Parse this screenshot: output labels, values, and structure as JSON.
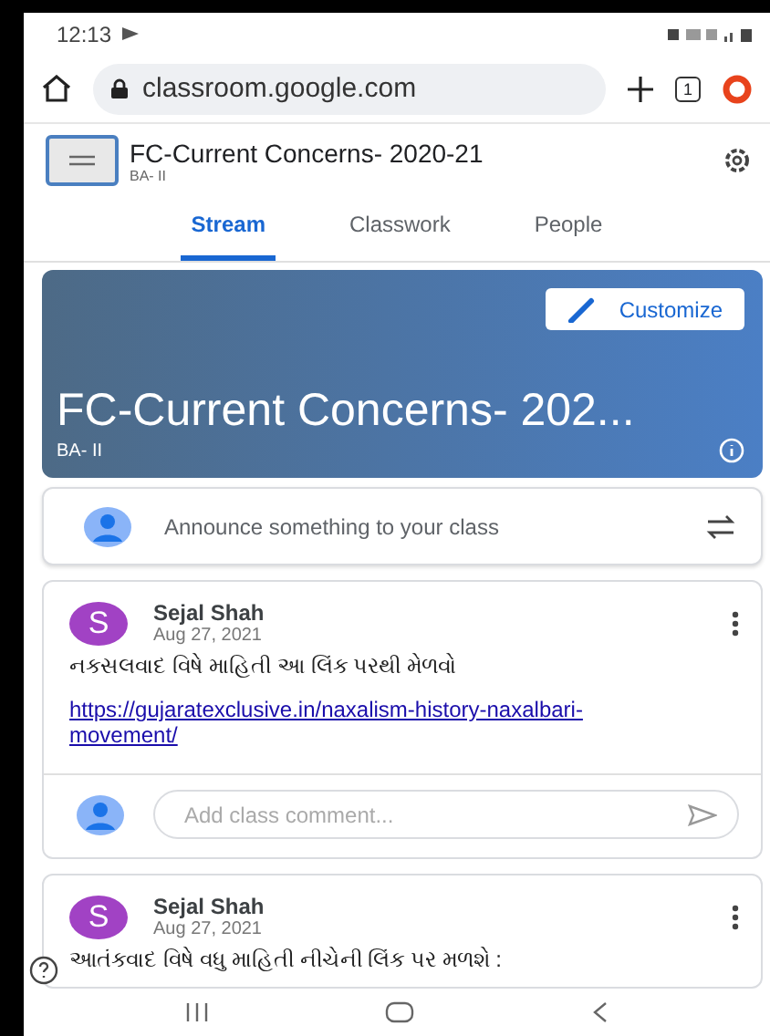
{
  "status_bar": {
    "time": "12:13"
  },
  "browser": {
    "url": "classroom.google.com",
    "tab_count": "1"
  },
  "class_header": {
    "title": "FC-Current Concerns- 2020-21",
    "subtitle": "BA- II"
  },
  "tabs": [
    {
      "label": "Stream",
      "selected": true
    },
    {
      "label": "Classwork",
      "selected": false
    },
    {
      "label": "People",
      "selected": false
    }
  ],
  "banner": {
    "button": "Customize",
    "title": "FC-Current Concerns- 202...",
    "subtitle": "BA- II"
  },
  "announce": {
    "placeholder": "Announce something to your class"
  },
  "posts": [
    {
      "initial": "S",
      "author": "Sejal Shah",
      "date": "Aug 27, 2021",
      "text": "નકસલવાદ વિષે માહિતી આ લિંક પરથી મેળવો",
      "link": "https://gujaratexclusive.in/naxalism-history-naxalbari-movement/",
      "comment_placeholder": "Add class comment..."
    },
    {
      "initial": "S",
      "author": "Sejal Shah",
      "date": "Aug 27, 2021",
      "text": "આતંકવાદ વિષે વધુ માહિતી નીચેની લિંક પર મળશે :"
    }
  ]
}
